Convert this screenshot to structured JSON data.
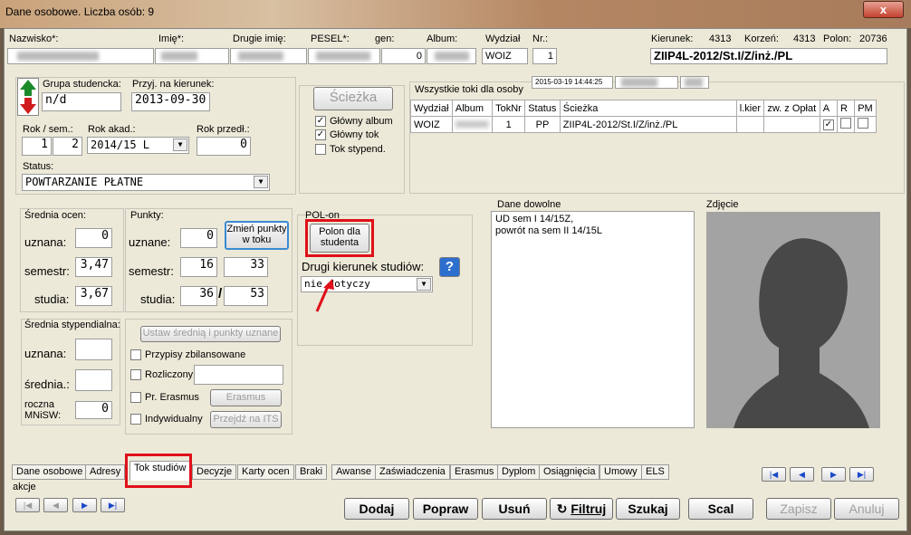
{
  "window": {
    "title": "Dane osobowe. Liczba osób: 9",
    "close": "x"
  },
  "header": {
    "labels": {
      "surname": "Nazwisko*:",
      "first_name": "Imię*:",
      "second_name": "Drugie imię:",
      "pesel": "PESEL*:",
      "gen": "gen:",
      "album": "Album:",
      "faculty": "Wydział",
      "nr": "Nr.:",
      "major": "Kierunek:",
      "major_val": "4313",
      "root": "Korzeń:",
      "root_val": "4313",
      "polon": "Polon:",
      "polon_val": "20736"
    },
    "values": {
      "gen": "0",
      "faculty": "WOIZ",
      "nr": "1",
      "path": "ZIIP4L-2012/St.I/Z/inż./PL"
    }
  },
  "left": {
    "group_label": "Grupa studencka:",
    "group_value": "n/d",
    "admitted_label": "Przyj. na kierunek:",
    "admitted_value": "2013-09-30",
    "year_sem_label": "Rok / sem.:",
    "year_val": "1",
    "sem_val": "2",
    "acad_year_label": "Rok akad.:",
    "acad_year_value": "2014/15 L",
    "prev_year_label": "Rok przedł.:",
    "prev_year_value": "0",
    "status_label": "Status:",
    "status_value": "POWTARZANIE PŁATNE"
  },
  "path_box": {
    "button": "Ścieżka",
    "main_album": "Główny album",
    "main_path": "Główny tok",
    "scholarship_path": "Tok stypend."
  },
  "all_paths": {
    "title": "Wszystkie toki dla osoby",
    "timestamp": "2015-03-19 14:44:25",
    "columns": [
      "Wydział",
      "Album",
      "TokNr",
      "Status",
      "Ścieżka",
      "l.kier",
      "zw. z Opłat",
      "A",
      "R",
      "PM"
    ],
    "row": {
      "faculty": "WOIZ",
      "toknr": "1",
      "status": "PP",
      "path": "ZIIP4L-2012/St.I/Z/inż./PL"
    }
  },
  "grades": {
    "title": "Średnia ocen:",
    "recognized": "uznana:",
    "recognized_val": "0",
    "semester": "semestr:",
    "semester_val": "3,47",
    "studies": "studia:",
    "studies_val": "3,67"
  },
  "points": {
    "title": "Punkty:",
    "recognized": "uznane:",
    "recognized_val": "0",
    "semester": "semestr:",
    "semester_a": "16",
    "semester_b": "33",
    "studies": "studia:",
    "studies_a": "36",
    "slash": "/",
    "studies_b": "53",
    "change_button": "Zmień punkty w toku"
  },
  "polon": {
    "title": "POL-on",
    "button": "Polon dla studenta",
    "second_major_label": "Drugi kierunek studiów:",
    "second_major_value": "nie dotyczy",
    "help": "?"
  },
  "extra": {
    "title": "Dane dowolne",
    "text": "UD sem I 14/15Z,\npowrót na sem II 14/15L"
  },
  "photo": {
    "title": "Zdjęcie"
  },
  "scholarship": {
    "title": "Średnia stypendialna:",
    "recognized": "uznana:",
    "average": "średnia.:",
    "annual": "roczna\nMNiSW:",
    "annual_val": "0"
  },
  "options": {
    "set_button": "Ustaw średnią i punkty uznane",
    "balanced": "Przypisy zbilansowane",
    "settled": "Rozliczony",
    "erasmus_check": "Pr. Erasmus",
    "erasmus_button": "Erasmus",
    "individual": "Indywidualny",
    "its_button": "Przejdź na ITS"
  },
  "tabs": [
    "Dane osobowe",
    "Adresy",
    "Tok studiów",
    "Decyzje",
    "Karty ocen",
    "Braki",
    "Awanse",
    "Zaświadczenia",
    "Erasmus",
    "Dyplom",
    "Osiągnięcia",
    "Umowy",
    "ELS"
  ],
  "actions_label": "akcje",
  "commands": {
    "add": "Dodaj",
    "edit": "Popraw",
    "delete": "Usuń",
    "filter": "Filtruj",
    "search": "Szukaj",
    "merge": "Scal",
    "save": "Zapisz",
    "cancel": "Anuluj"
  },
  "colors": {
    "highlight": "#e0101a",
    "accent": "#1a48c8"
  }
}
